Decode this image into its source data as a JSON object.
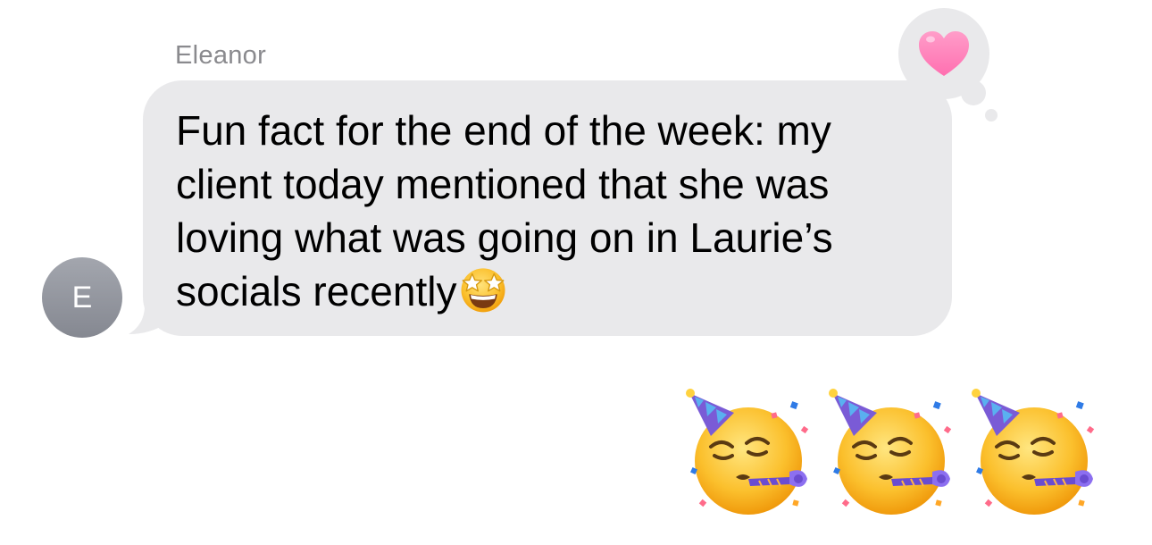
{
  "conversation": {
    "sender": {
      "name": "Eleanor",
      "avatar_initial": "E"
    },
    "message": {
      "text": "Fun fact for the end of the week: my\nclient today mentioned that she was\nloving what was going on in Laurie’s\nsocials recently",
      "inline_emoji": "star-struck-emoji",
      "tapback": "pink-heart-icon"
    },
    "reply": {
      "emojis": [
        "partying-face-emoji",
        "partying-face-emoji",
        "partying-face-emoji"
      ]
    }
  },
  "colors": {
    "incoming_bubble": "#e9e9eb",
    "sender_name": "#8a8a8e",
    "avatar": "#8f929a",
    "heart": "#ff8fbf",
    "background": "#ffffff"
  }
}
